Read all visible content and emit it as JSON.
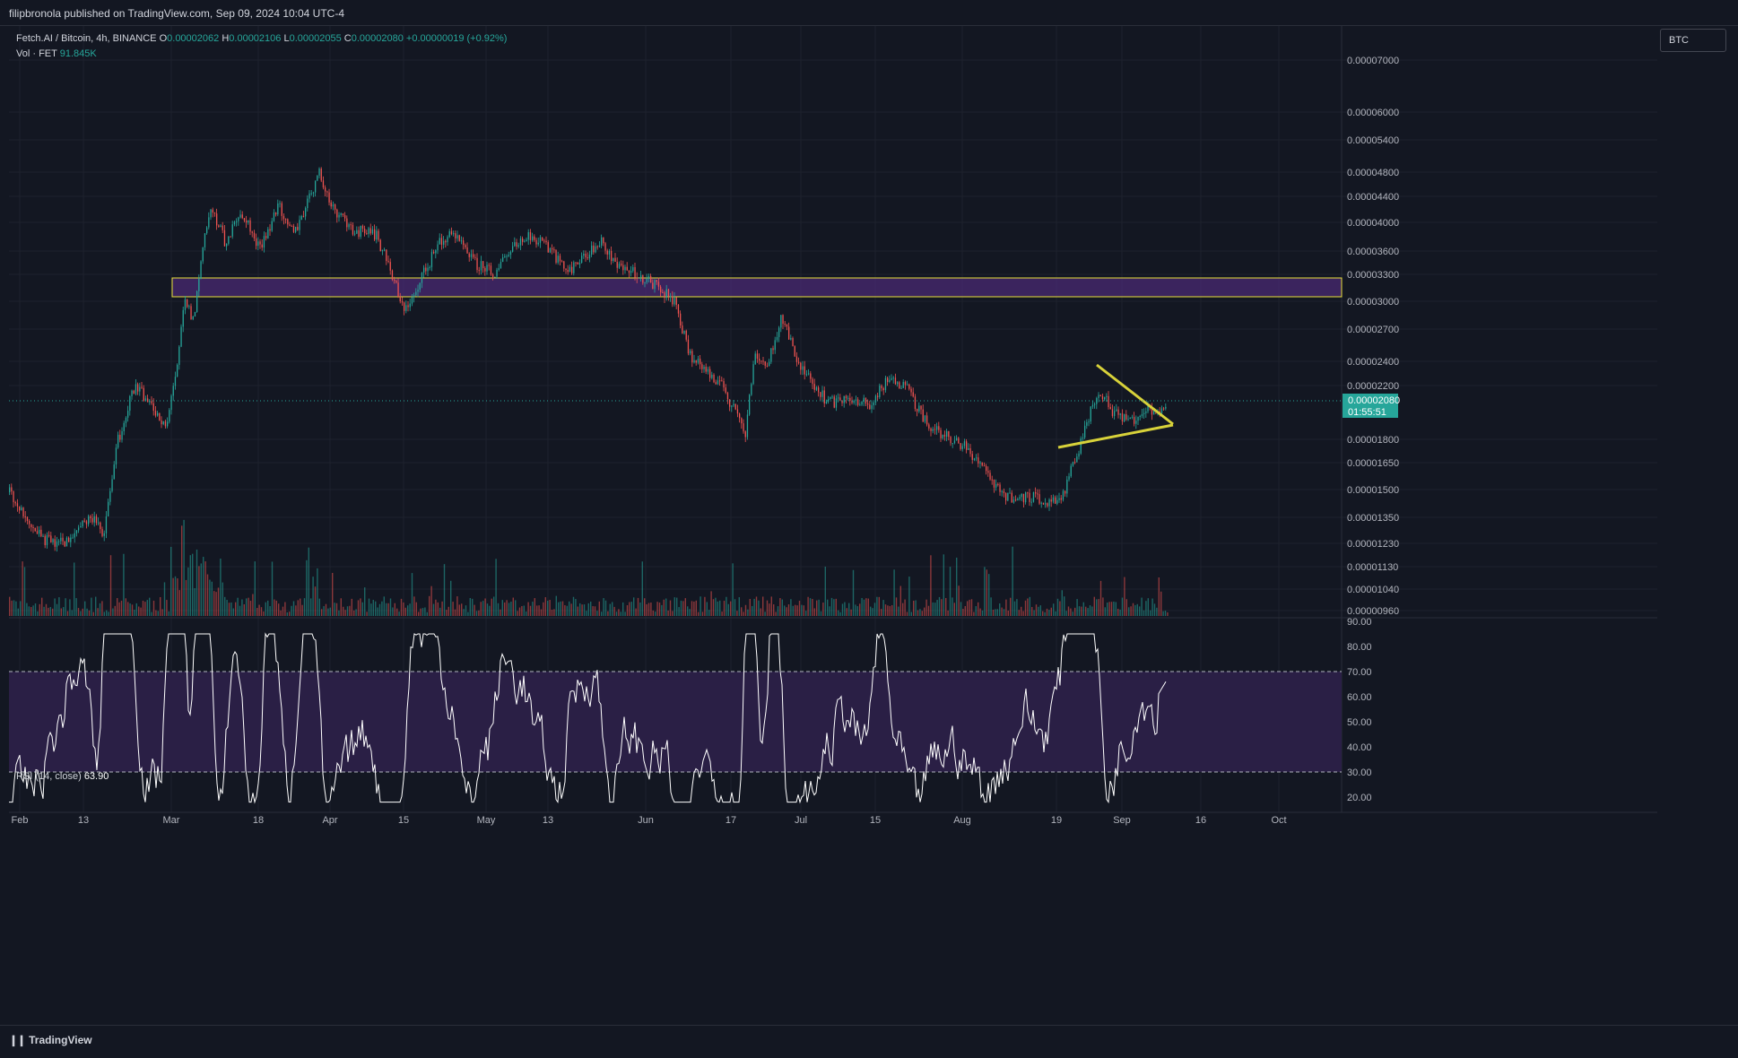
{
  "header": {
    "publish_info": "filipbronola published on TradingView.com, Sep 09, 2024 10:04 UTC-4"
  },
  "legend": {
    "symbol": "Fetch.AI / Bitcoin, 4h, BINANCE",
    "o_label": "O",
    "o_value": "0.00002062",
    "h_label": "H",
    "h_value": "0.00002106",
    "l_label": "L",
    "l_value": "0.00002055",
    "c_label": "C",
    "c_value": "0.00002080",
    "change": "+0.00000019 (+0.92%)",
    "vol_label": "Vol · FET",
    "vol_value": "91.845K"
  },
  "rsi_legend": {
    "label": "RSI (14, close)",
    "value": "63.90"
  },
  "currency_badge": "BTC",
  "price_axis": {
    "labels": [
      "0.00007000",
      "0.00006000",
      "0.00005400",
      "0.00004800",
      "0.00004400",
      "0.00004000",
      "0.00003600",
      "0.00003300",
      "0.00003000",
      "0.00002700",
      "0.00002400",
      "0.00002200",
      "0.00001800",
      "0.00001650",
      "0.00001500",
      "0.00001350",
      "0.00001230",
      "0.00001130",
      "0.00001040",
      "0.00000960"
    ],
    "current_price": "0.00002080",
    "countdown": "01:55:51"
  },
  "rsi_axis": {
    "labels": [
      "90.00",
      "80.00",
      "70.00",
      "60.00",
      "50.00",
      "40.00",
      "30.00",
      "20.00"
    ]
  },
  "time_axis": {
    "labels": [
      "Feb",
      "13",
      "Mar",
      "18",
      "Apr",
      "15",
      "May",
      "13",
      "Jun",
      "17",
      "Jul",
      "15",
      "Aug",
      "19",
      "Sep",
      "16",
      "Oct"
    ]
  },
  "colors": {
    "background": "#131722",
    "grid": "#1e222d",
    "up": "#26a69a",
    "down": "#ef5350",
    "zone_fill": "#4a2a73",
    "zone_border": "#e8e03a",
    "triangle": "#d8d23a",
    "rsi_band": "#2a1f45",
    "rsi_line": "#ffffff",
    "price_tag": "#26a69a"
  },
  "footer": {
    "brand": "TradingView",
    "logo_icon": "tradingview-logo-icon"
  }
}
